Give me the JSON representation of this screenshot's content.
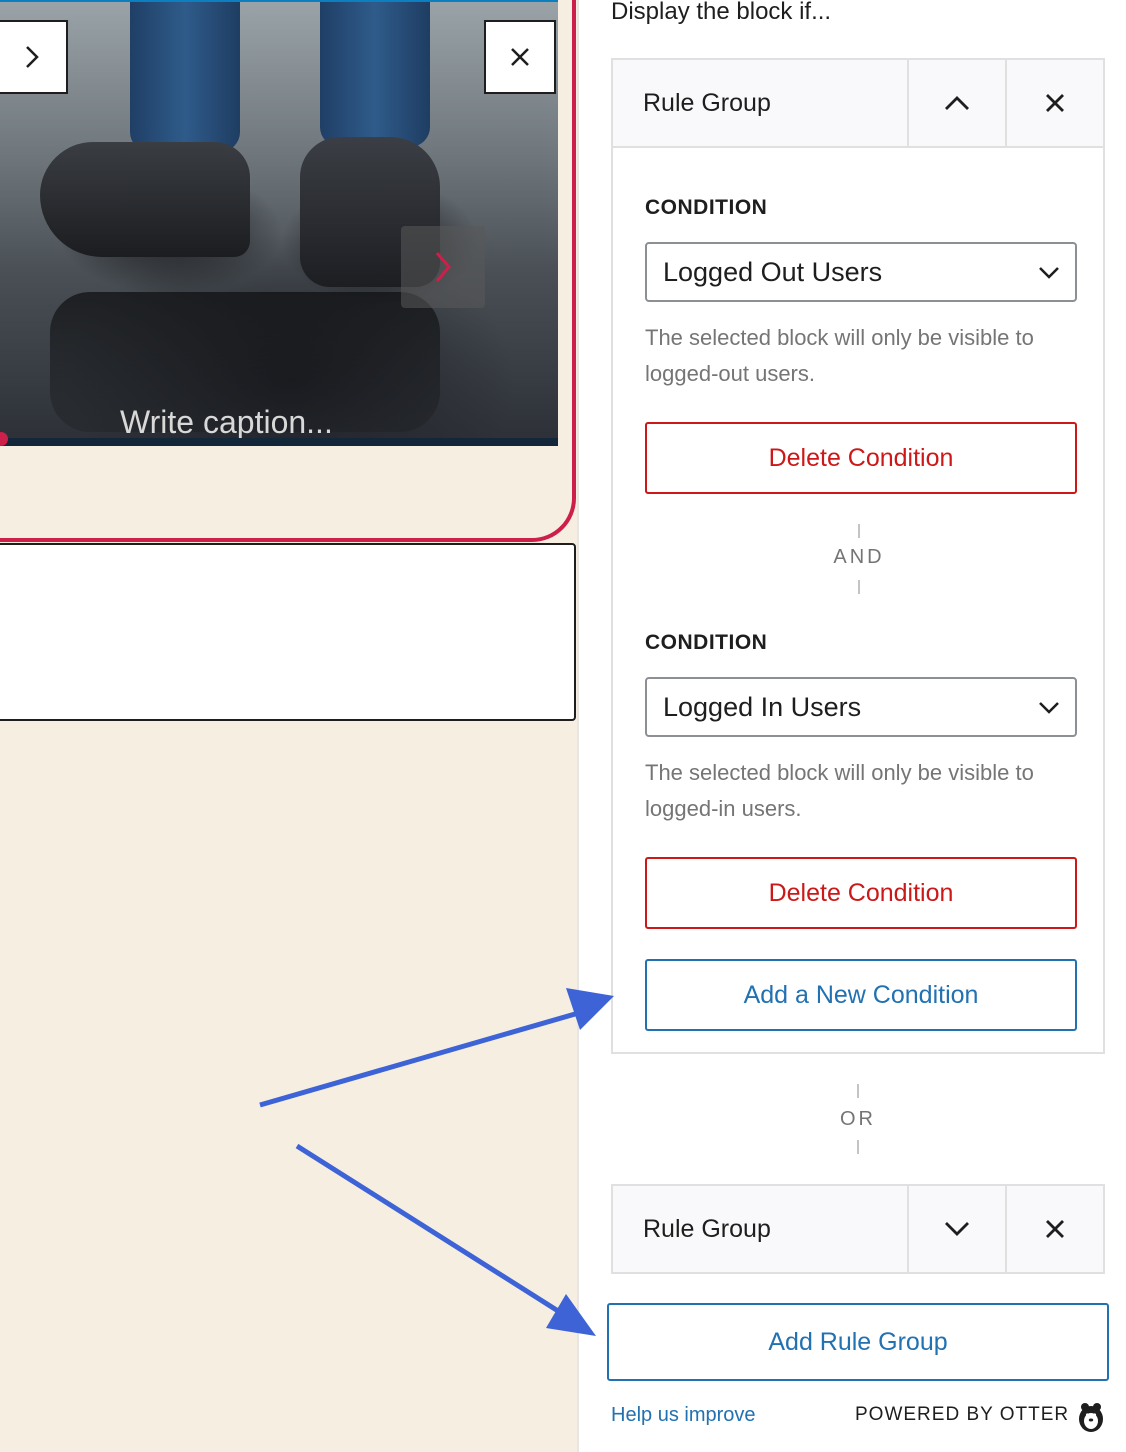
{
  "editor": {
    "slider": {
      "caption_placeholder": "Write caption..."
    }
  },
  "sidebar": {
    "title": "Display the block if...",
    "rule_groups": [
      {
        "title": "Rule Group",
        "expanded": true,
        "conditions": [
          {
            "label": "CONDITION",
            "value": "Logged Out Users",
            "help": "The selected block will only be visible to logged-out users.",
            "delete_label": "Delete Condition"
          },
          {
            "label": "CONDITION",
            "value": "Logged In Users",
            "help": "The selected block will only be visible to logged-in users.",
            "delete_label": "Delete Condition"
          }
        ],
        "and_label": "AND",
        "add_condition_label": "Add a New Condition"
      },
      {
        "title": "Rule Group",
        "expanded": false
      }
    ],
    "or_label": "OR",
    "add_group_label": "Add Rule Group",
    "footer": {
      "help_link": "Help us improve",
      "powered_by": "POWERED BY OTTER"
    }
  },
  "colors": {
    "accent": "#2271b1",
    "danger": "#cc1818",
    "slider_border": "#cc1f4a",
    "canvas_bg": "#f6eee1",
    "annotation_arrow": "#3d63d6"
  },
  "icons": {
    "next": "chevron-right-icon",
    "close": "close-icon",
    "collapse": "chevron-up-icon",
    "expand": "chevron-down-icon",
    "remove": "close-icon",
    "select": "chevron-down-icon",
    "brand": "otter-icon"
  }
}
